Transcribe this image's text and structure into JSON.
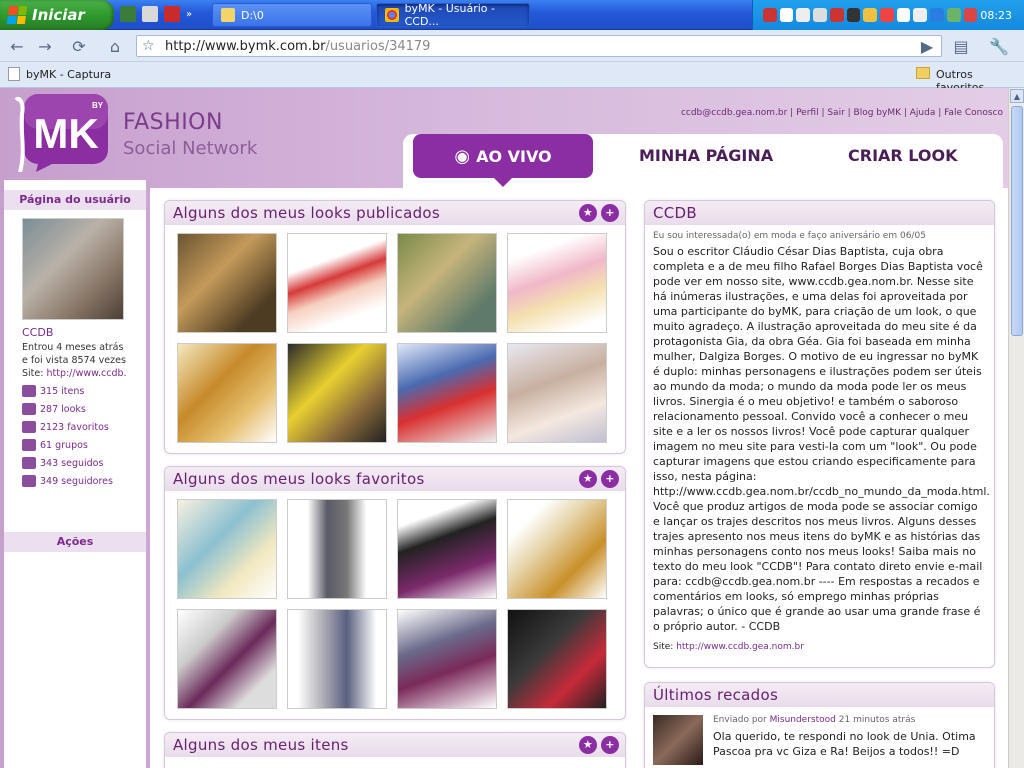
{
  "taskbar": {
    "start_label": "Iniciar",
    "tasks": [
      {
        "label": "D:\\0",
        "active": false
      },
      {
        "label": "byMK - Usuário - CCD...",
        "active": true
      }
    ],
    "clock": "08:23"
  },
  "browser": {
    "url_host": "http://www.bymk.com.br",
    "url_path": "/usuarios/34179",
    "bookmark_left": "byMK - Captura",
    "bookmark_right": "Outros favoritos"
  },
  "header": {
    "logo_text": "MK",
    "logo_by": "BY",
    "brand_line1": "FASHION",
    "brand_line2": "Social Network",
    "toplinks": "ccdb@ccdb.gea.nom.br | Perfil | Sair | Blog byMK | Ajuda | Fale Conosco",
    "tabs": [
      {
        "label": "AO VIVO"
      },
      {
        "label": "MINHA PÁGINA"
      },
      {
        "label": "CRIAR LOOK"
      }
    ]
  },
  "sidebar": {
    "title": "Página do usuário",
    "name": "CCDB",
    "info1": "Entrou 4 meses atrás",
    "info2": "e foi vista 8574 vezes",
    "site_label": "Site:",
    "site_link": "http://www.ccdb.",
    "stats": [
      {
        "label": "315 itens"
      },
      {
        "label": "287 looks"
      },
      {
        "label": "2123 favoritos"
      },
      {
        "label": "61 grupos"
      },
      {
        "label": "343 seguidos"
      },
      {
        "label": "349 seguidores"
      }
    ],
    "actions_title": "Ações"
  },
  "panels": {
    "published_title": "Alguns dos meus looks publicados",
    "favorites_title": "Alguns dos meus looks favoritos",
    "items_title": "Alguns dos meus itens"
  },
  "about": {
    "title": "CCDB",
    "meta": "Eu sou interessada(o) em moda e faço aniversário em 06/05",
    "text": "Sou o escritor Cláudio César Dias Baptista, cuja obra completa e a de meu filho Rafael Borges Dias Baptista você pode ver em nosso site, www.ccdb.gea.nom.br. Nesse site há inúmeras ilustrações, e uma delas foi aproveitada por uma participante do byMK, para criação de um look, o que muito agradeço. A ilustração aproveitada do meu site é da protagonista Gia, da obra Géa. Gia foi baseada em minha mulher, Dalgiza Borges. O motivo de eu ingressar no byMK é duplo: minhas personagens e ilustrações podem ser úteis ao mundo da moda; o mundo da moda pode ler os meus livros. Sinergia é o meu objetivo! e também o saboroso relacionamento pessoal. Convido você a conhecer o meu site e a ler os nossos livros! Você pode capturar qualquer imagem no meu site para vesti-la com um \"look\". Ou pode capturar imagens que estou criando especificamente para isso, nesta página: http://www.ccdb.gea.nom.br/ccdb_no_mundo_da_moda.html. Você que produz artigos de moda pode se associar comigo e lançar os trajes descritos nos meus livros. Alguns desses trajes apresento nos meus itens do byMK e as histórias das minhas personagens conto nos meus looks! Saiba mais no texto do meu look \"CCDB\"! Para contato direto envie e-mail para: ccdb@ccdb.gea.nom.br ---- Em respostas a recados e comentários em looks, só emprego minhas próprias palavras; o único que é grande ao usar uma grande frase é o próprio autor. - CCDB",
    "site_label": "Site:",
    "site_link": "http://www.ccdb.gea.nom.br"
  },
  "messages": {
    "title": "Últimos recados",
    "sent_by": "Enviado por",
    "author": "Misunderstood",
    "time": "21 minutos atrás",
    "text": "Ola querido, te respondi no look de Unia. Otima Pascoa pra vc Giza e Ra! Beijos a todos!! =D"
  }
}
